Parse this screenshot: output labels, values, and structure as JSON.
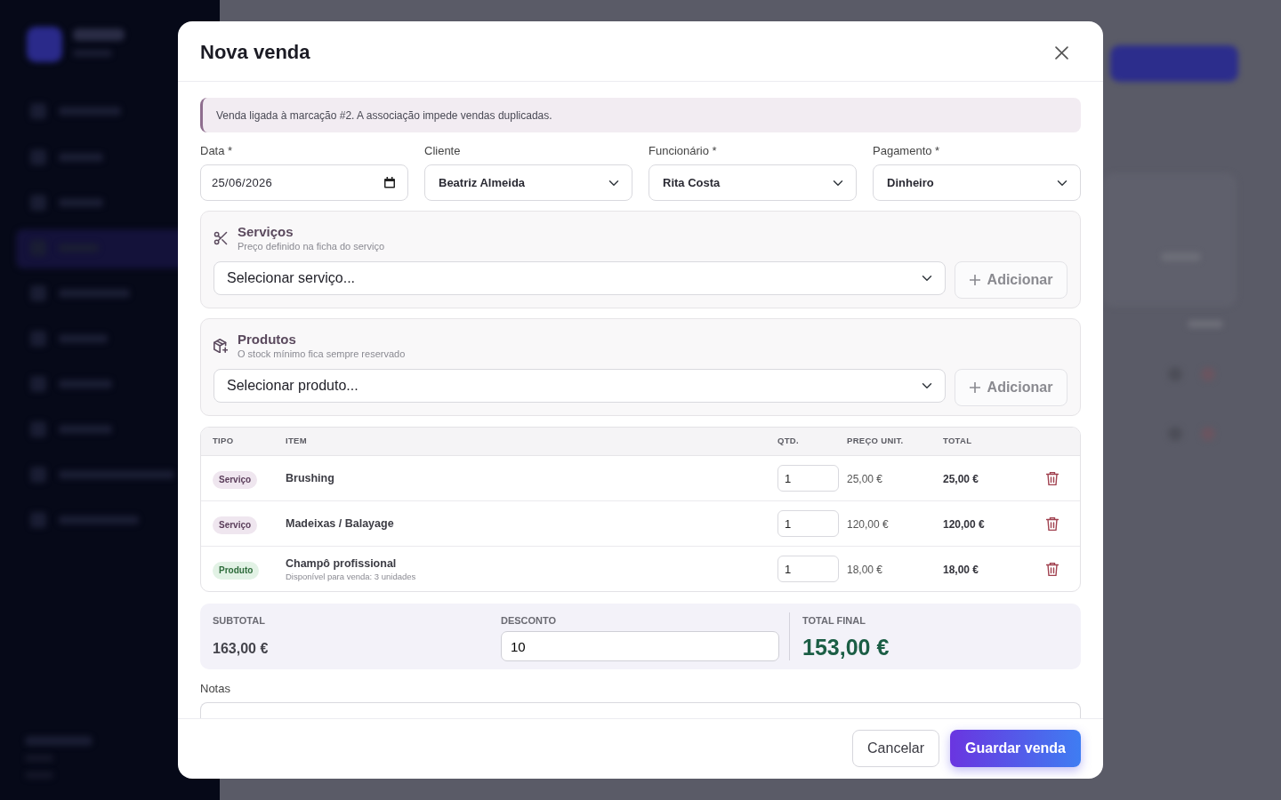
{
  "modal": {
    "title": "Nova venda"
  },
  "alert": {
    "text": "Venda ligada à marcação #2. A associação impede vendas duplicadas."
  },
  "fields": [
    {
      "label": "Data *",
      "kind": "date",
      "value": "25/06/2026"
    },
    {
      "label": "Cliente",
      "kind": "select",
      "value": "Beatriz Almeida"
    },
    {
      "label": "Funcionário *",
      "kind": "select",
      "value": "Rita Costa"
    },
    {
      "label": "Pagamento *",
      "kind": "select",
      "value": "Dinheiro"
    }
  ],
  "sections": [
    {
      "kind": "services",
      "title": "Serviços",
      "subtitle": "Preço definido na ficha do serviço",
      "value": "Selecionar serviço...",
      "button": "Adicionar"
    },
    {
      "kind": "products",
      "title": "Produtos",
      "subtitle": "O stock mínimo fica sempre reservado",
      "value": "Selecionar produto...",
      "button": "Adicionar"
    }
  ],
  "items_table": {
    "columns": [
      "TIPO",
      "ITEM",
      "QTD.",
      "PREÇO UNIT.",
      "TOTAL"
    ],
    "rows": [
      {
        "kind": "service",
        "type": "Serviço",
        "item": "Brushing",
        "qty": "1",
        "unit_price": "25,00 €",
        "total": "25,00 €"
      },
      {
        "kind": "service",
        "type": "Serviço",
        "item": "Madeixas / Balayage",
        "qty": "1",
        "unit_price": "120,00 €",
        "total": "120,00 €"
      },
      {
        "kind": "product",
        "type": "Produto",
        "item": "Champô profissional",
        "note": "Disponível para venda: 3 unidades",
        "qty": "1",
        "unit_price": "18,00 €",
        "total": "18,00 €"
      }
    ]
  },
  "summary": {
    "subtotal_label": "SUBTOTAL",
    "subtotal": "163,00 €",
    "discount_label": "DESCONTO",
    "discount": "10",
    "total_label": "TOTAL FINAL",
    "total": "153,00 €"
  },
  "notes": {
    "label": "Notas"
  },
  "footer_buttons": [
    {
      "kind": "secondary",
      "label": "Cancelar"
    },
    {
      "kind": "primary",
      "label": "Guardar venda"
    }
  ]
}
